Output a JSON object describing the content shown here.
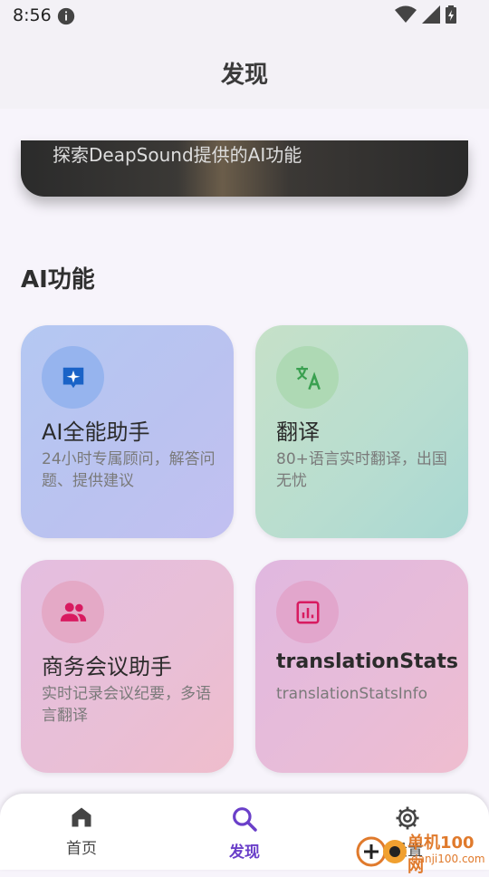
{
  "status_bar": {
    "time": "8:56"
  },
  "app_bar": {
    "title": "发现"
  },
  "banner": {
    "text": "探索DeapSound提供的AI功能"
  },
  "section": {
    "title": "AI功能"
  },
  "cards": [
    {
      "title": "AI全能助手",
      "desc": "24小时专属顾问，解答问题、提供建议",
      "icon": "sparkle-icon",
      "color": "#1a63c7"
    },
    {
      "title": "翻译",
      "desc": "80+语言实时翻译，出国无忧",
      "icon": "translate-icon",
      "color": "#3aa050"
    },
    {
      "title": "商务会议助手",
      "desc": "实时记录会议纪要，多语言翻译",
      "icon": "people-icon",
      "color": "#d81b60"
    },
    {
      "title": "translationStats",
      "desc": "translationStatsInfo",
      "icon": "stats-icon",
      "color": "#d81b60"
    }
  ],
  "bottom_nav": {
    "items": [
      {
        "label": "首页",
        "icon": "home-icon"
      },
      {
        "label": "发现",
        "icon": "search-icon"
      },
      {
        "label": "设置",
        "icon": "gear-icon"
      }
    ],
    "active": "发现",
    "active_color": "#6a3fc9"
  },
  "watermark": {
    "text": "单机100网",
    "sub": "danji100.com"
  }
}
